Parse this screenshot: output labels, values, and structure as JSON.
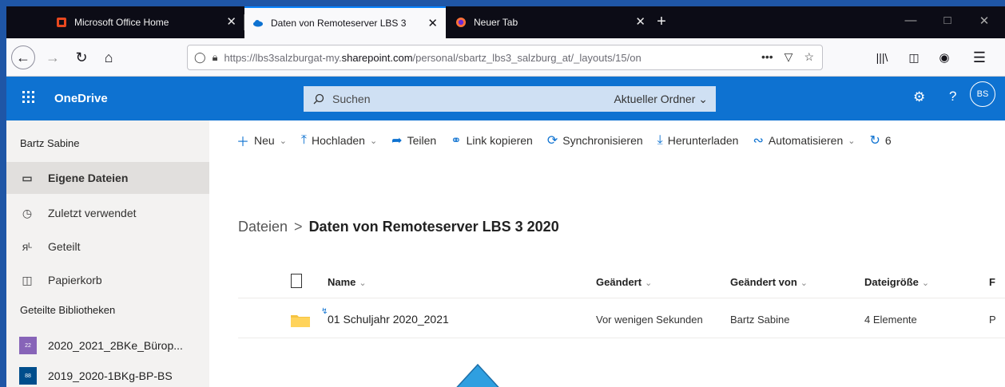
{
  "browser": {
    "tabs": [
      {
        "title": "Microsoft Office Home",
        "icon": "office-icon",
        "active": false
      },
      {
        "title": "Daten von Remoteserver LBS 3",
        "icon": "onedrive-cloud-icon",
        "active": true
      },
      {
        "title": "Neuer Tab",
        "icon": "firefox-icon",
        "active": false
      }
    ],
    "tab_close": "✕",
    "new_tab": "+",
    "url_prefix": "https://lbs3salzburgat-my.",
    "url_domain": "sharepoint.com",
    "url_suffix": "/personal/sbartz_lbs3_salzburg_at/_layouts/15/on",
    "url_more": "•••"
  },
  "suite": {
    "app_name": "OneDrive",
    "search_placeholder": "Suchen",
    "search_scope": "Aktueller Ordner",
    "avatar_initials": "BS",
    "help": "?"
  },
  "leftnav": {
    "user_name": "Bartz Sabine",
    "items": [
      {
        "label": "Eigene Dateien",
        "icon": "folder-icon",
        "active": true
      },
      {
        "label": "Zuletzt verwendet",
        "icon": "clock-icon",
        "active": false
      },
      {
        "label": "Geteilt",
        "icon": "people-icon",
        "active": false
      },
      {
        "label": "Papierkorb",
        "icon": "recycle-bin-icon",
        "active": false
      }
    ],
    "section_title": "Geteilte Bibliotheken",
    "libraries": [
      {
        "label": "2020_2021_2BKe_Bürop...",
        "badge": "22",
        "color": "#8764b8"
      },
      {
        "label": "2019_2020-1BKg-BP-BS",
        "badge": "88",
        "color": "#004e8c"
      }
    ]
  },
  "commands": [
    {
      "label": "Neu",
      "icon": "plus-icon",
      "dropdown": true
    },
    {
      "label": "Hochladen",
      "icon": "upload-icon",
      "dropdown": true
    },
    {
      "label": "Teilen",
      "icon": "share-icon",
      "dropdown": false
    },
    {
      "label": "Link kopieren",
      "icon": "link-icon",
      "dropdown": false
    },
    {
      "label": "Synchronisieren",
      "icon": "sync-icon",
      "dropdown": false
    },
    {
      "label": "Herunterladen",
      "icon": "download-icon",
      "dropdown": false
    },
    {
      "label": "Automatisieren",
      "icon": "automate-icon",
      "dropdown": true
    },
    {
      "label": "6",
      "icon": "refresh-icon",
      "dropdown": false
    }
  ],
  "breadcrumb": {
    "root": "Dateien",
    "separator": ">",
    "current": "Daten von Remoteserver LBS 3 2020"
  },
  "list": {
    "columns": [
      "Name",
      "Geändert",
      "Geändert von",
      "Dateigröße",
      "F"
    ],
    "rows": [
      {
        "name": "01 Schuljahr 2020_2021",
        "modified": "Vor wenigen Sekunden",
        "modified_by": "Bartz Sabine",
        "size": "4 Elemente",
        "extra": "P",
        "type": "folder"
      }
    ]
  },
  "colors": {
    "suite_blue": "#0e72d1",
    "folder_yellow": "#f5c342",
    "arrow_blue": "#2f9fe0"
  }
}
